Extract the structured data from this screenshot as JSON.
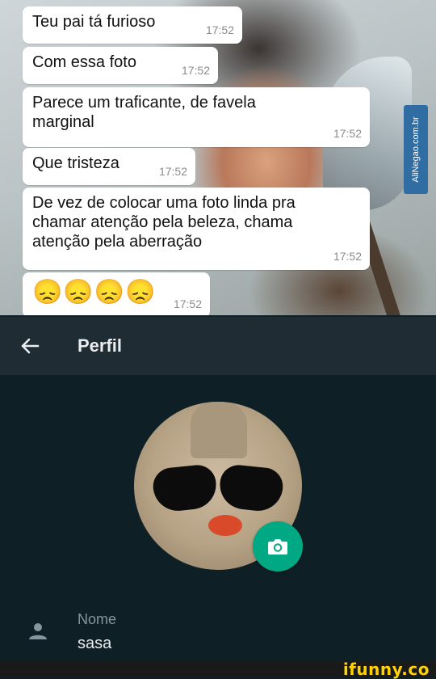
{
  "chat": {
    "watermark": "AliNegao.com.br",
    "messages": [
      {
        "text": "Teu pai tá furioso",
        "time": "17:52"
      },
      {
        "text": "Com essa foto",
        "time": "17:52"
      },
      {
        "text": "Parece um traficante, de favela\nmarginal",
        "time": "17:52"
      },
      {
        "text": "Que tristeza",
        "time": "17:52"
      },
      {
        "text": "De vez de colocar uma foto linda pra\nchamar atenção pela beleza, chama\natenção pela aberração",
        "time": "17:52"
      },
      {
        "text": "😞😞😞😞",
        "time": "17:52"
      }
    ]
  },
  "appbar": {
    "title": "Perfil",
    "back_icon": "arrow-left-icon"
  },
  "profile": {
    "camera_icon": "camera-icon",
    "accent": "#00a884",
    "name_label": "Nome",
    "name_value": "sasa",
    "name_icon": "person-icon"
  },
  "footer": {
    "watermark": "ifunny.co"
  }
}
